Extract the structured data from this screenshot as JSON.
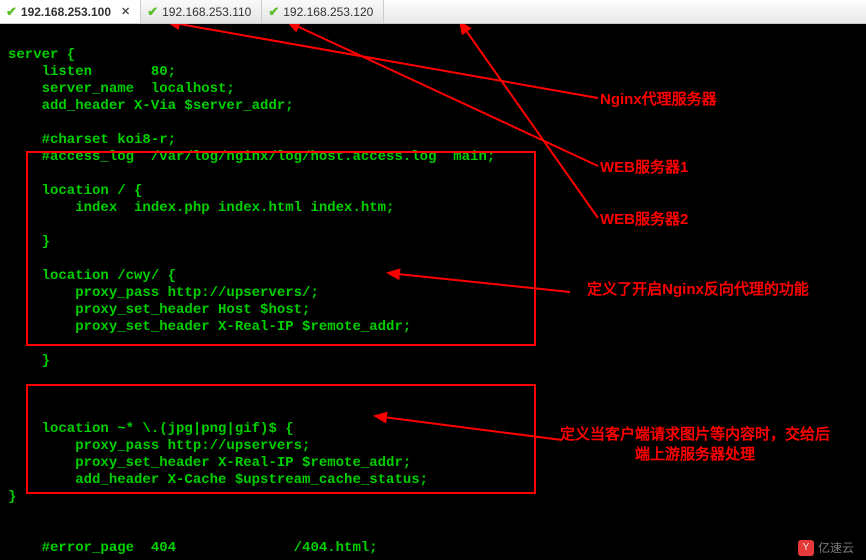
{
  "tabs": [
    {
      "ip": "192.168.253.100",
      "active": true,
      "closable": true
    },
    {
      "ip": "192.168.253.110",
      "active": false,
      "closable": false
    },
    {
      "ip": "192.168.253.120",
      "active": false,
      "closable": false
    }
  ],
  "code": {
    "l1": "server {",
    "l2": "    listen       80;",
    "l3": "    server_name  localhost;",
    "l4": "    add_header X-Via $server_addr;",
    "l5": "",
    "l6": "    #charset koi8-r;",
    "l7": "    #access_log  /var/log/nginx/log/host.access.log  main;",
    "l8": "",
    "l9": "    location / {",
    "l10": "        index  index.php index.html index.htm;",
    "l11": "",
    "l12": "    }",
    "l13": "",
    "l14": "    location /cwy/ {",
    "l15": "        proxy_pass http://upservers/;",
    "l16": "        proxy_set_header Host $host;",
    "l17": "        proxy_set_header X-Real-IP $remote_addr;",
    "l18": "",
    "l19": "    }",
    "l20": "",
    "l21": "",
    "l22": "",
    "l23": "    location ~* \\.(jpg|png|gif)$ {",
    "l24": "        proxy_pass http://upservers;",
    "l25": "        proxy_set_header X-Real-IP $remote_addr;",
    "l26": "        add_header X-Cache $upstream_cache_status;",
    "l27": "}",
    "l28": "",
    "l29": "",
    "l30": "    #error_page  404              /404.html;"
  },
  "annotations": {
    "a1": "Nginx代理服务器",
    "a2": "WEB服务器1",
    "a3": "WEB服务器2",
    "a4": "定义了开启Nginx反向代理的功能",
    "a5": "定义当客户端请求图片等内容时，交给后端上游服务器处理"
  },
  "watermark": "亿速云"
}
